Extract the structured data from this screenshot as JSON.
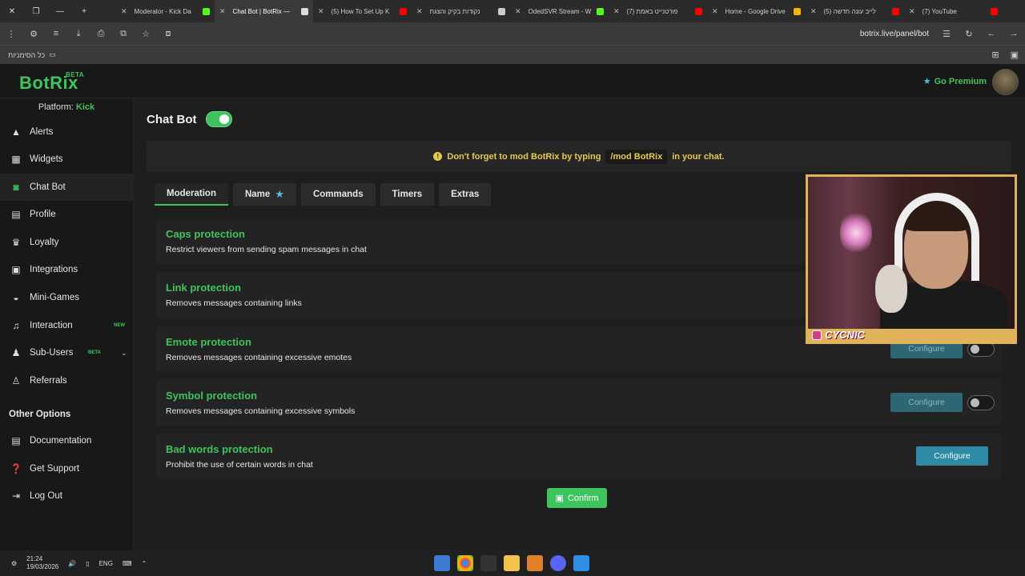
{
  "browser": {
    "tabs": [
      {
        "label": "Moderator - Kick Da",
        "color": "#53fc18"
      },
      {
        "label": "Chat Bot | BotRix —",
        "color": "#e6e6e6",
        "active": true
      },
      {
        "label": "(5) How To Set Up K",
        "color": "#ff0000"
      },
      {
        "label": "נקודות בקיק והצגת",
        "color": "#cccccc"
      },
      {
        "label": "OdedSVR Stream - W",
        "color": "#53fc18"
      },
      {
        "label": "פורטנייט באמת (7)",
        "color": "#ff0000"
      },
      {
        "label": "Home - Google Drive",
        "color": "#f4b400"
      },
      {
        "label": "לייב עונה חדשה (5)",
        "color": "#ff0000"
      },
      {
        "label": "(7) YouTube",
        "color": "#ff0000"
      }
    ],
    "url": "botrix.live/panel/bot",
    "bookmarks_label": "כל הסימניות"
  },
  "brand": {
    "name": "BotRix",
    "beta": "BETA",
    "premium_label": "Go Premium",
    "accent": "#3ec45c"
  },
  "sidebar": {
    "platform_label": "Platform:",
    "platform_value": "Kick",
    "items": [
      {
        "label": "Alerts",
        "icon": "warning-icon"
      },
      {
        "label": "Widgets",
        "icon": "grid-icon"
      },
      {
        "label": "Chat Bot",
        "icon": "robot-icon",
        "active": true
      },
      {
        "label": "Profile",
        "icon": "id-card-icon"
      },
      {
        "label": "Loyalty",
        "icon": "trophy-icon"
      },
      {
        "label": "Integrations",
        "icon": "puzzle-icon"
      },
      {
        "label": "Mini-Games",
        "icon": "gamepad-icon"
      },
      {
        "label": "Interaction",
        "icon": "music-icon",
        "badge": "NEW"
      },
      {
        "label": "Sub-Users",
        "icon": "users-icon",
        "badge": "BETA"
      },
      {
        "label": "Referrals",
        "icon": "referrals-icon"
      }
    ],
    "other_heading": "Other Options",
    "other_items": [
      {
        "label": "Documentation",
        "icon": "doc-icon"
      },
      {
        "label": "Get Support",
        "icon": "help-icon"
      },
      {
        "label": "Log Out",
        "icon": "logout-icon"
      }
    ]
  },
  "main": {
    "title": "Chat Bot",
    "notice_prefix": "Don't forget to mod BotRix by typing",
    "notice_code": "/mod BotRix",
    "notice_suffix": "in your chat.",
    "tabs": [
      "Moderation",
      "Name",
      "Commands",
      "Timers",
      "Extras"
    ],
    "cards": [
      {
        "title": "Caps protection",
        "desc": "Restrict viewers from sending spam messages in chat"
      },
      {
        "title": "Link protection",
        "desc": "Removes messages containing links"
      },
      {
        "title": "Emote protection",
        "desc": "Removes messages containing excessive emotes",
        "configure": "Configure"
      },
      {
        "title": "Symbol protection",
        "desc": "Removes messages containing excessive symbols",
        "configure": "Configure"
      },
      {
        "title": "Bad words protection",
        "desc": "Prohibit the use of certain words in chat",
        "configure": "Configure"
      }
    ],
    "confirm_label": "Confirm"
  },
  "overlay": {
    "streamer_name": "CYCNIC"
  },
  "taskbar": {
    "time": "21:24",
    "date": "19/03/2026",
    "lang": "ENG"
  }
}
